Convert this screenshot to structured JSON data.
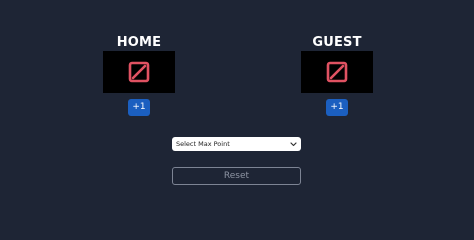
{
  "teams": {
    "home": {
      "name": "HOME",
      "increment_label": "+1",
      "score_icon": "slashed-zero-digit-icon"
    },
    "guest": {
      "name": "GUEST",
      "increment_label": "+1",
      "score_icon": "slashed-zero-digit-icon"
    }
  },
  "max_point_select": {
    "selected": "Select Max Point",
    "icon": "chevron-down-icon"
  },
  "reset": {
    "label": "Reset"
  },
  "colors": {
    "background": "#1e2535",
    "score_display": "#000000",
    "score_digit": "#e05262",
    "increment_button": "#1b5fc0",
    "reset_border": "#7d8494"
  }
}
